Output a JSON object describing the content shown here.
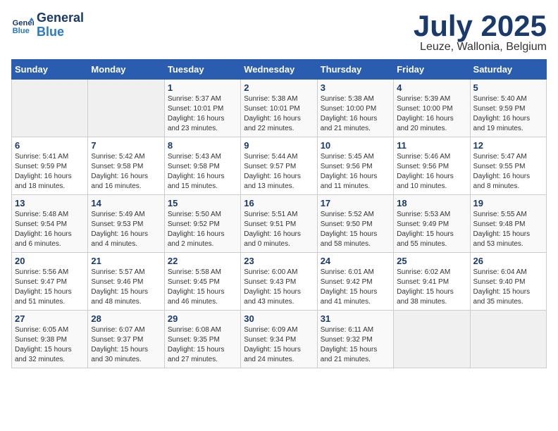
{
  "header": {
    "logo_line1": "General",
    "logo_line2": "Blue",
    "month": "July 2025",
    "location": "Leuze, Wallonia, Belgium"
  },
  "weekdays": [
    "Sunday",
    "Monday",
    "Tuesday",
    "Wednesday",
    "Thursday",
    "Friday",
    "Saturday"
  ],
  "weeks": [
    [
      {
        "day": "",
        "text": ""
      },
      {
        "day": "",
        "text": ""
      },
      {
        "day": "1",
        "text": "Sunrise: 5:37 AM\nSunset: 10:01 PM\nDaylight: 16 hours\nand 23 minutes."
      },
      {
        "day": "2",
        "text": "Sunrise: 5:38 AM\nSunset: 10:01 PM\nDaylight: 16 hours\nand 22 minutes."
      },
      {
        "day": "3",
        "text": "Sunrise: 5:38 AM\nSunset: 10:00 PM\nDaylight: 16 hours\nand 21 minutes."
      },
      {
        "day": "4",
        "text": "Sunrise: 5:39 AM\nSunset: 10:00 PM\nDaylight: 16 hours\nand 20 minutes."
      },
      {
        "day": "5",
        "text": "Sunrise: 5:40 AM\nSunset: 9:59 PM\nDaylight: 16 hours\nand 19 minutes."
      }
    ],
    [
      {
        "day": "6",
        "text": "Sunrise: 5:41 AM\nSunset: 9:59 PM\nDaylight: 16 hours\nand 18 minutes."
      },
      {
        "day": "7",
        "text": "Sunrise: 5:42 AM\nSunset: 9:58 PM\nDaylight: 16 hours\nand 16 minutes."
      },
      {
        "day": "8",
        "text": "Sunrise: 5:43 AM\nSunset: 9:58 PM\nDaylight: 16 hours\nand 15 minutes."
      },
      {
        "day": "9",
        "text": "Sunrise: 5:44 AM\nSunset: 9:57 PM\nDaylight: 16 hours\nand 13 minutes."
      },
      {
        "day": "10",
        "text": "Sunrise: 5:45 AM\nSunset: 9:56 PM\nDaylight: 16 hours\nand 11 minutes."
      },
      {
        "day": "11",
        "text": "Sunrise: 5:46 AM\nSunset: 9:56 PM\nDaylight: 16 hours\nand 10 minutes."
      },
      {
        "day": "12",
        "text": "Sunrise: 5:47 AM\nSunset: 9:55 PM\nDaylight: 16 hours\nand 8 minutes."
      }
    ],
    [
      {
        "day": "13",
        "text": "Sunrise: 5:48 AM\nSunset: 9:54 PM\nDaylight: 16 hours\nand 6 minutes."
      },
      {
        "day": "14",
        "text": "Sunrise: 5:49 AM\nSunset: 9:53 PM\nDaylight: 16 hours\nand 4 minutes."
      },
      {
        "day": "15",
        "text": "Sunrise: 5:50 AM\nSunset: 9:52 PM\nDaylight: 16 hours\nand 2 minutes."
      },
      {
        "day": "16",
        "text": "Sunrise: 5:51 AM\nSunset: 9:51 PM\nDaylight: 16 hours\nand 0 minutes."
      },
      {
        "day": "17",
        "text": "Sunrise: 5:52 AM\nSunset: 9:50 PM\nDaylight: 15 hours\nand 58 minutes."
      },
      {
        "day": "18",
        "text": "Sunrise: 5:53 AM\nSunset: 9:49 PM\nDaylight: 15 hours\nand 55 minutes."
      },
      {
        "day": "19",
        "text": "Sunrise: 5:55 AM\nSunset: 9:48 PM\nDaylight: 15 hours\nand 53 minutes."
      }
    ],
    [
      {
        "day": "20",
        "text": "Sunrise: 5:56 AM\nSunset: 9:47 PM\nDaylight: 15 hours\nand 51 minutes."
      },
      {
        "day": "21",
        "text": "Sunrise: 5:57 AM\nSunset: 9:46 PM\nDaylight: 15 hours\nand 48 minutes."
      },
      {
        "day": "22",
        "text": "Sunrise: 5:58 AM\nSunset: 9:45 PM\nDaylight: 15 hours\nand 46 minutes."
      },
      {
        "day": "23",
        "text": "Sunrise: 6:00 AM\nSunset: 9:43 PM\nDaylight: 15 hours\nand 43 minutes."
      },
      {
        "day": "24",
        "text": "Sunrise: 6:01 AM\nSunset: 9:42 PM\nDaylight: 15 hours\nand 41 minutes."
      },
      {
        "day": "25",
        "text": "Sunrise: 6:02 AM\nSunset: 9:41 PM\nDaylight: 15 hours\nand 38 minutes."
      },
      {
        "day": "26",
        "text": "Sunrise: 6:04 AM\nSunset: 9:40 PM\nDaylight: 15 hours\nand 35 minutes."
      }
    ],
    [
      {
        "day": "27",
        "text": "Sunrise: 6:05 AM\nSunset: 9:38 PM\nDaylight: 15 hours\nand 32 minutes."
      },
      {
        "day": "28",
        "text": "Sunrise: 6:07 AM\nSunset: 9:37 PM\nDaylight: 15 hours\nand 30 minutes."
      },
      {
        "day": "29",
        "text": "Sunrise: 6:08 AM\nSunset: 9:35 PM\nDaylight: 15 hours\nand 27 minutes."
      },
      {
        "day": "30",
        "text": "Sunrise: 6:09 AM\nSunset: 9:34 PM\nDaylight: 15 hours\nand 24 minutes."
      },
      {
        "day": "31",
        "text": "Sunrise: 6:11 AM\nSunset: 9:32 PM\nDaylight: 15 hours\nand 21 minutes."
      },
      {
        "day": "",
        "text": ""
      },
      {
        "day": "",
        "text": ""
      }
    ]
  ]
}
